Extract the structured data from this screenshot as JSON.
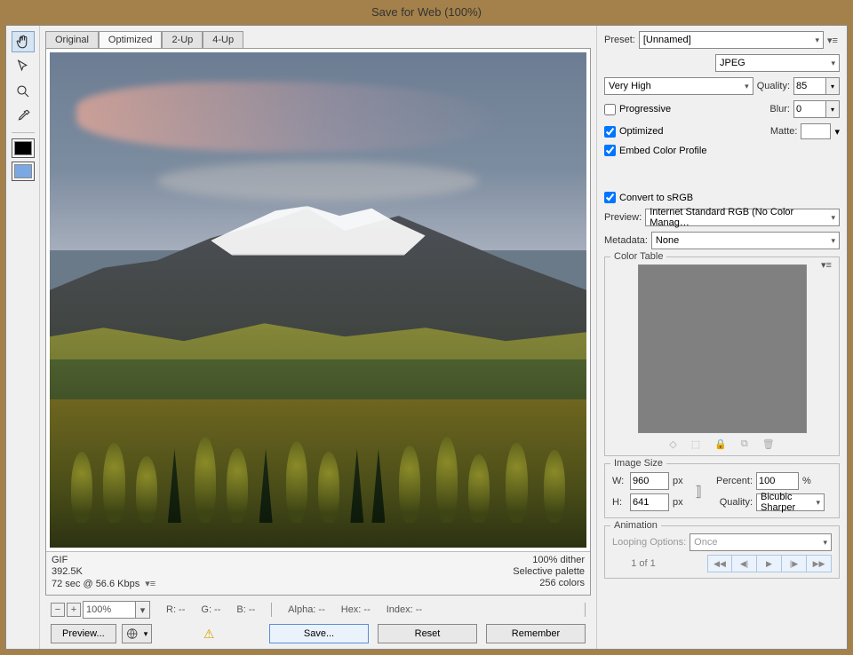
{
  "title": "Save for Web (100%)",
  "tabs": [
    "Original",
    "Optimized",
    "2-Up",
    "4-Up"
  ],
  "active_tab": 1,
  "status": {
    "format": "GIF",
    "size": "392.5K",
    "timing": "72 sec @ 56.6 Kbps",
    "dither": "100% dither",
    "palette": "Selective palette",
    "colors": "256 colors"
  },
  "zoom": {
    "value": "100%"
  },
  "readouts": {
    "r": "R: --",
    "g": "G: --",
    "b": "B: --",
    "alpha": "Alpha: --",
    "hex": "Hex: --",
    "index": "Index: --"
  },
  "buttons": {
    "preview": "Preview...",
    "save": "Save...",
    "reset": "Reset",
    "remember": "Remember"
  },
  "preset": {
    "label": "Preset:",
    "value": "[Unnamed]",
    "format": "JPEG",
    "quality_preset": "Very High",
    "quality_label": "Quality:",
    "quality_value": "85",
    "progressive_label": "Progressive",
    "progressive_checked": false,
    "blur_label": "Blur:",
    "blur_value": "0",
    "optimized_label": "Optimized",
    "optimized_checked": true,
    "matte_label": "Matte:",
    "embed_label": "Embed Color Profile",
    "embed_checked": true
  },
  "color": {
    "convert_label": "Convert to sRGB",
    "convert_checked": true,
    "preview_label": "Preview:",
    "preview_value": "Internet Standard RGB (No Color Manag…",
    "metadata_label": "Metadata:",
    "metadata_value": "None",
    "table_label": "Color Table"
  },
  "image_size": {
    "label": "Image Size",
    "w_label": "W:",
    "w_value": "960",
    "h_label": "H:",
    "h_value": "641",
    "px": "px",
    "percent_label": "Percent:",
    "percent_value": "100",
    "percent_suffix": "%",
    "quality_label": "Quality:",
    "quality_value": "Bicubic Sharper"
  },
  "animation": {
    "label": "Animation",
    "looping_label": "Looping Options:",
    "looping_value": "Once",
    "status": "1 of 1"
  }
}
